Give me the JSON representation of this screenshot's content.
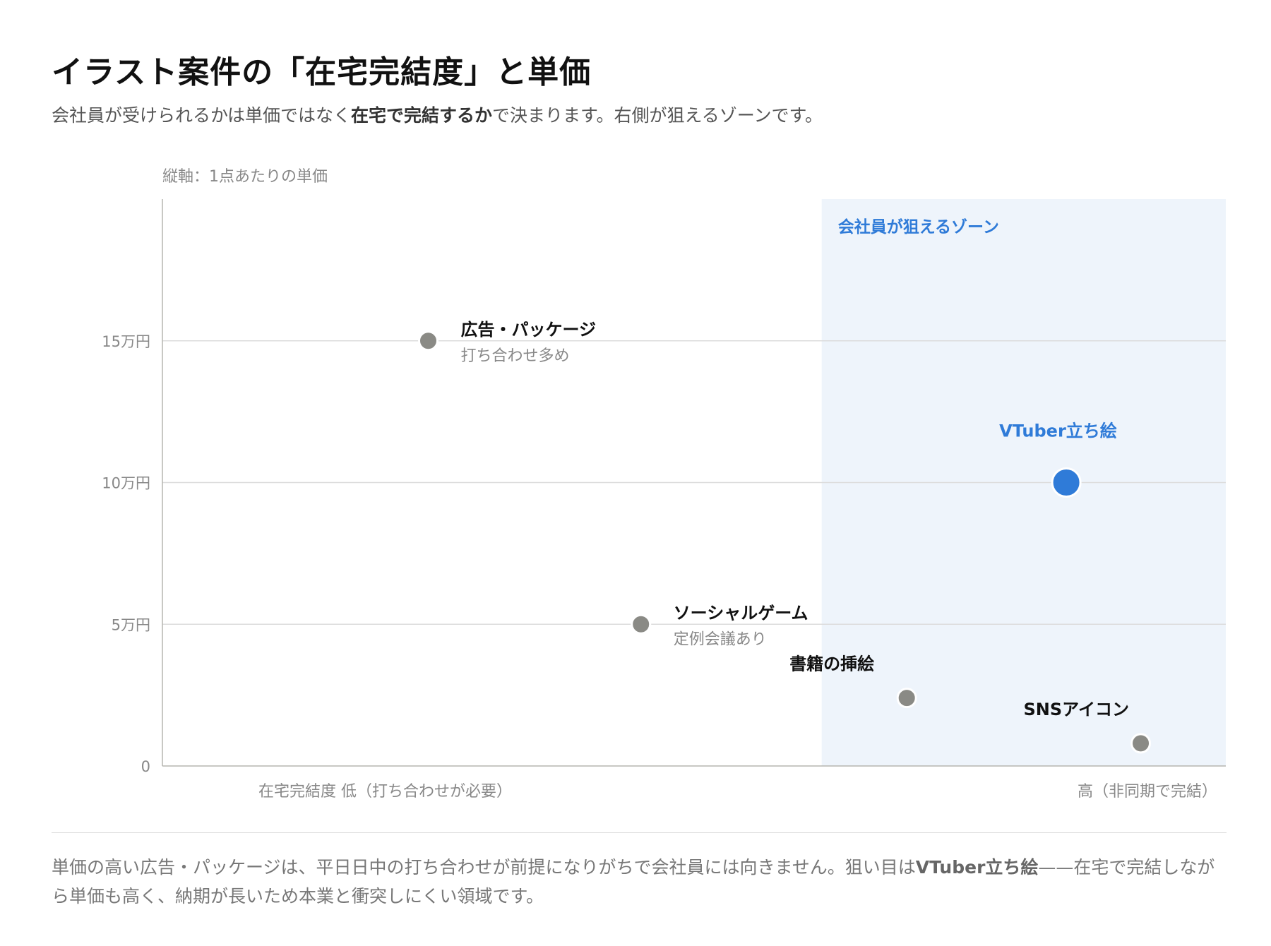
{
  "header": {
    "title": "イラスト案件の「在宅完結度」と単価",
    "subtitle_pre": "会社員が受けられるかは単価ではなく",
    "subtitle_bold": "在宅で完結するか",
    "subtitle_post": "で決まります。右側が狙えるゾーンです。"
  },
  "footer": {
    "pre": "単価の高い広告・パッケージは、平日日中の打ち合わせが前提になりがちで会社員には向きません。狙い目は",
    "bold": "VTuber立ち絵",
    "post": "——在宅で完結しながら単価も高く、納期が長いため本業と衝突しにくい領域です。"
  },
  "colors": {
    "accent": "#2f7bd8",
    "zone_fill": "#eef4fb",
    "point_gray": "#8a8a85",
    "grid": "#dcdcdc",
    "axis": "#b5b5b0"
  },
  "chart_data": {
    "type": "scatter",
    "ylabel": "縦軸：1点あたりの単価",
    "xlabel_low": "在宅完結度 低（打ち合わせが必要）",
    "xlabel_high": "高（非同期で完結）",
    "ylim": [
      0,
      20
    ],
    "xlim": [
      0,
      100
    ],
    "y_ticks": [
      {
        "value": 0,
        "label": "0"
      },
      {
        "value": 5,
        "label": "5万円"
      },
      {
        "value": 10,
        "label": "10万円"
      },
      {
        "value": 15,
        "label": "15万円"
      }
    ],
    "zone": {
      "label": "会社員が狙えるゾーン",
      "x_start": 62,
      "x_end": 100
    },
    "points": [
      {
        "name": "広告・パッケージ",
        "note": "打ち合わせ多め",
        "x": 25,
        "y": 15,
        "highlight": false,
        "label_side": "right"
      },
      {
        "name": "ソーシャルゲーム",
        "note": "定例会議あり",
        "x": 45,
        "y": 5,
        "highlight": false,
        "label_side": "right"
      },
      {
        "name": "書籍の挿絵",
        "note": "",
        "x": 70,
        "y": 2.4,
        "highlight": false,
        "label_side": "above-left"
      },
      {
        "name": "SNSアイコン",
        "note": "",
        "x": 92,
        "y": 0.8,
        "highlight": false,
        "label_side": "above-left"
      },
      {
        "name": "VTuber立ち絵",
        "note": "",
        "x": 85,
        "y": 10,
        "highlight": true,
        "label_side": "above"
      }
    ]
  }
}
